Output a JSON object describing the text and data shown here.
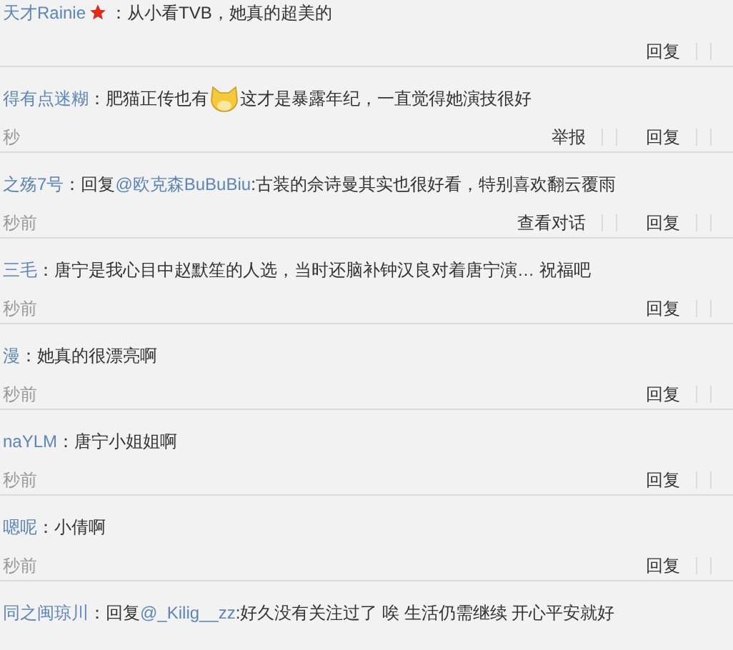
{
  "comments": [
    {
      "user": "天才Rainie",
      "starred": true,
      "body": [
        {
          "kind": "text",
          "text": "：从小看TVB，她真的超美的"
        }
      ],
      "actions": [
        "回复"
      ]
    },
    {
      "user": "得有点迷糊",
      "body": [
        {
          "kind": "text",
          "text": "：肥猫正传也有"
        },
        {
          "kind": "emoji"
        },
        {
          "kind": "text",
          "text": "这才是暴露年纪，一直觉得她演技很好"
        }
      ],
      "time": "秒",
      "actions": [
        "举报",
        "回复"
      ]
    },
    {
      "user": "之殇7号",
      "body": [
        {
          "kind": "text",
          "text": "：回复"
        },
        {
          "kind": "mention",
          "text": "@欧克森BuBuBiu"
        },
        {
          "kind": "text",
          "text": ":古装的佘诗曼其实也很好看，特别喜欢翻云覆雨"
        }
      ],
      "time": "秒前",
      "actions": [
        "查看对话",
        "回复"
      ]
    },
    {
      "user": "三毛",
      "body": [
        {
          "kind": "text",
          "text": "：唐宁是我心目中赵默笙的人选，当时还脑补钟汉良对着唐宁演… 祝福吧"
        }
      ],
      "time": "秒前",
      "actions": [
        "回复"
      ]
    },
    {
      "user": "漫",
      "body": [
        {
          "kind": "text",
          "text": "：她真的很漂亮啊"
        }
      ],
      "time": "秒前",
      "actions": [
        "回复"
      ]
    },
    {
      "user": "naYLM",
      "body": [
        {
          "kind": "text",
          "text": "：唐宁小姐姐啊"
        }
      ],
      "time": "秒前",
      "actions": [
        "回复"
      ]
    },
    {
      "user": "嗯呢",
      "body": [
        {
          "kind": "text",
          "text": "：小倩啊"
        }
      ],
      "time": "秒前",
      "actions": [
        "回复"
      ]
    },
    {
      "user": "同之闽琼川",
      "body": [
        {
          "kind": "text",
          "text": "：回复"
        },
        {
          "kind": "mention",
          "text": "@_Kilig__zz"
        },
        {
          "kind": "text",
          "text": ":好久没有关注过了 唉 生活仍需继续 开心平安就好"
        }
      ]
    }
  ]
}
